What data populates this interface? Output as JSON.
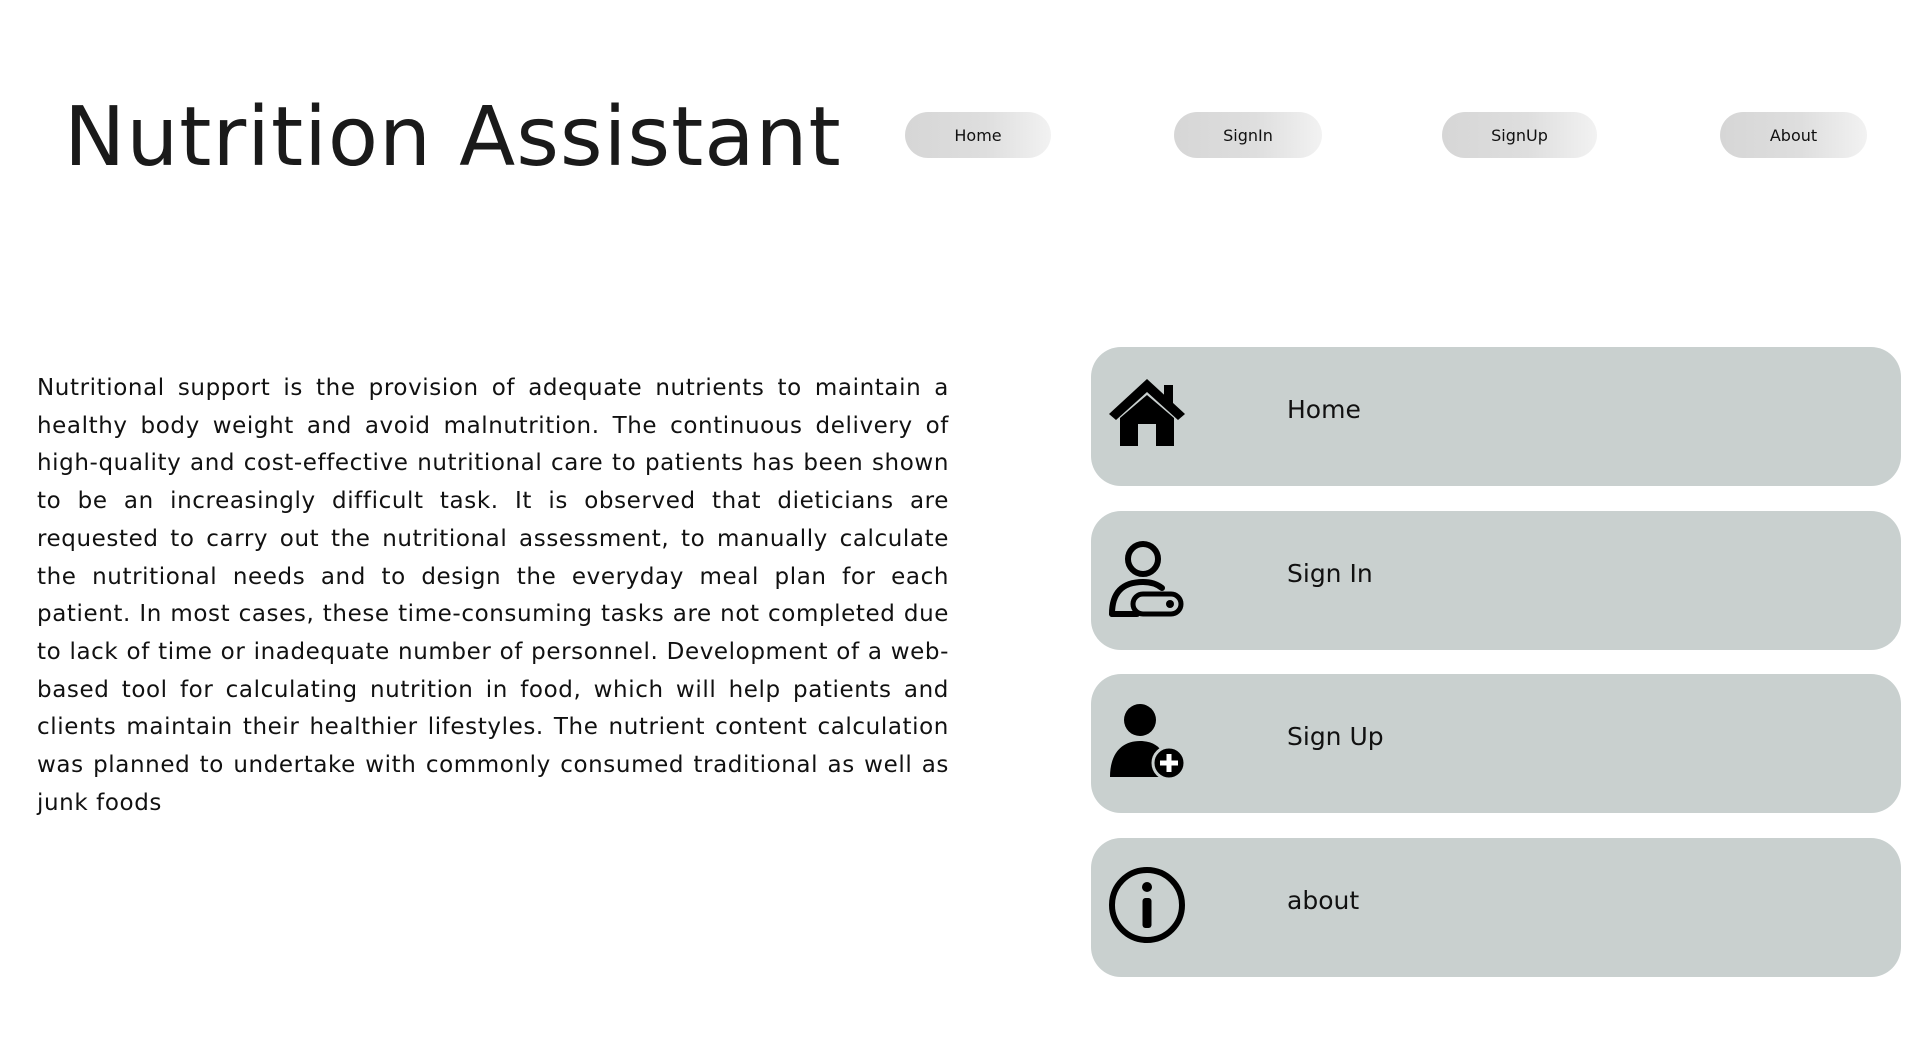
{
  "header": {
    "title": "Nutrition Assistant"
  },
  "nav": {
    "home": "Home",
    "signin": "SignIn",
    "signup": "SignUp",
    "about": "About"
  },
  "intro": {
    "text": "Nutritional support is the provision of adequate nutrients to maintain a healthy body weight and avoid malnutrition. The continuous delivery of high-quality and cost-effective nutritional care to patients has been shown to be an increasingly difficult task. It is observed that dieticians are requested to carry out the nutritional assessment, to manually calculate the nutritional needs and to design the everyday meal plan for each patient. In most cases, these time-consuming tasks are not completed due to lack of time or inadequate number of personnel. Development of a web-based tool for calculating nutrition in food, which will help patients and clients maintain their healthier lifestyles. The nutrient content calculation was planned to undertake with commonly consumed traditional as well as junk foods"
  },
  "menu": {
    "items": [
      {
        "label": "Home",
        "icon": "house-icon"
      },
      {
        "label": "Sign In",
        "icon": "user-key-icon"
      },
      {
        "label": "Sign Up",
        "icon": "user-plus-icon"
      },
      {
        "label": "about",
        "icon": "info-circle-icon"
      }
    ]
  },
  "colors": {
    "card_background": "#c9d0cf",
    "nav_pill": "#dedede",
    "text": "#111111"
  }
}
